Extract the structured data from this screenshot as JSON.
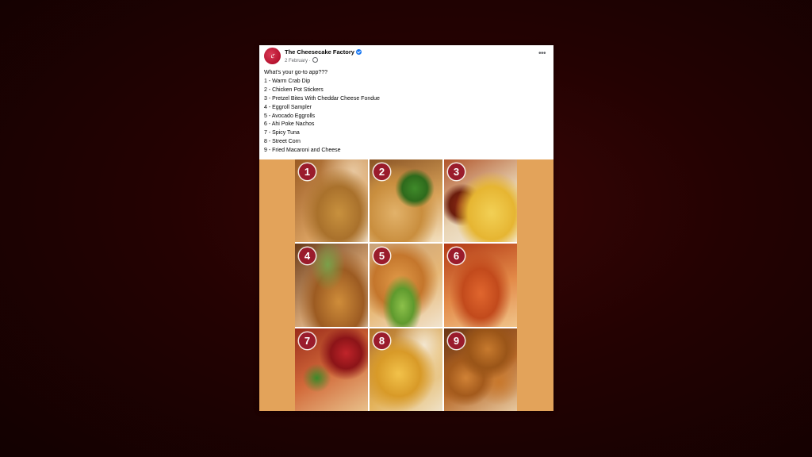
{
  "post": {
    "author": "The Cheesecake Factory",
    "date": "2 February",
    "date_separator": "·",
    "more_label": "•••",
    "caption_lines": [
      "What’s your go-to app???",
      "1 - Warm Crab Dip",
      "2 - Chicken Pot Stickers",
      "3 - Pretzel Bites With Cheddar Cheese Fondue",
      "4 - Eggroll Sampler",
      "5 - Avocado Eggrolls",
      "6 - Ahi Poke Nachos",
      "7 - Spicy Tuna",
      "8 - Street Corn",
      "9 - Fried Macaroni and Cheese"
    ]
  },
  "image_grid": {
    "tiles": [
      {
        "number": "1"
      },
      {
        "number": "2"
      },
      {
        "number": "3"
      },
      {
        "number": "4"
      },
      {
        "number": "5"
      },
      {
        "number": "6"
      },
      {
        "number": "7"
      },
      {
        "number": "8"
      },
      {
        "number": "9"
      }
    ]
  },
  "colors": {
    "background": "#240202",
    "badge": "#9a1c2c",
    "image_backdrop": "#e3a35a",
    "verified": "#1877f2"
  }
}
